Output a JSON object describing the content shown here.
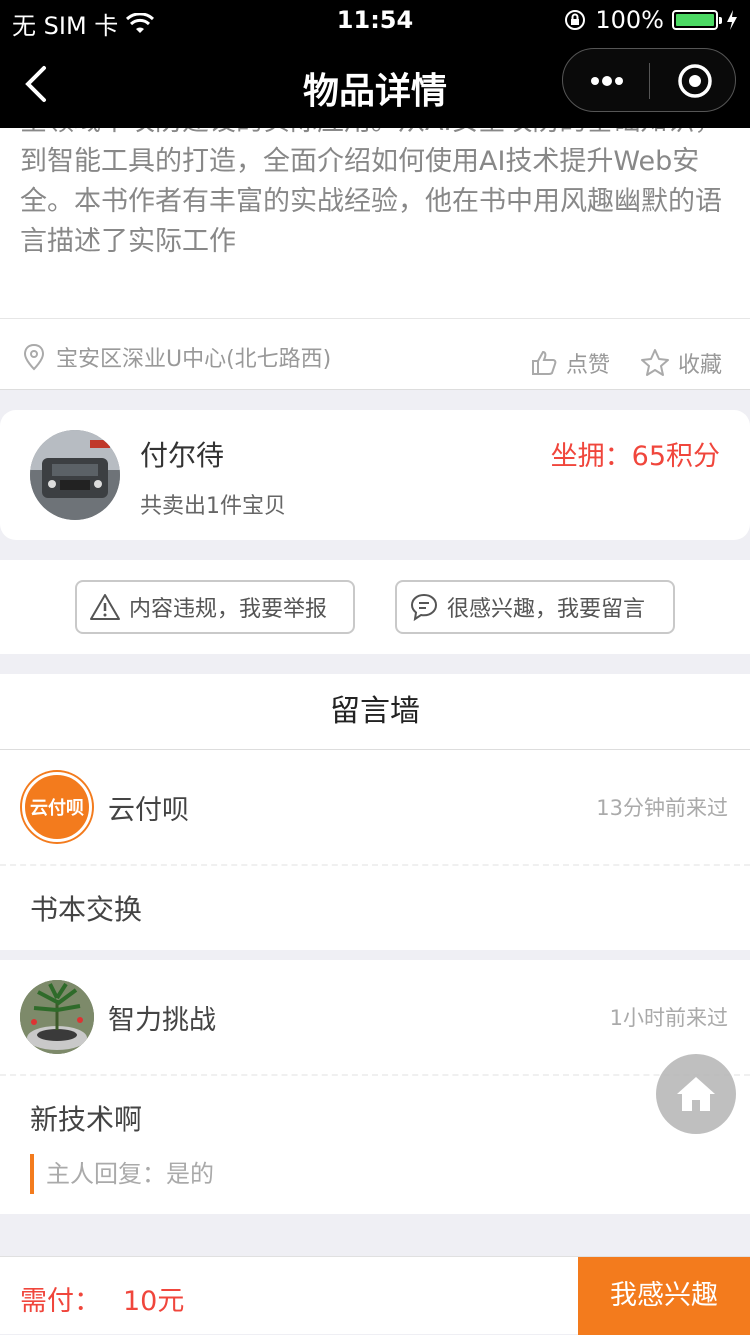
{
  "status_bar": {
    "carrier": "无 SIM 卡",
    "time": "11:54",
    "battery": "100%"
  },
  "nav": {
    "title": "物品详情"
  },
  "description": {
    "text": "全领域中攻防建设的实际应用。从AI安全攻防的基础知识，到智能工具的打造，全面介绍如何使用AI技术提升Web安全。本书作者有丰富的实战经验，他在书中用风趣幽默的语言描述了实际工作"
  },
  "location": {
    "address": "宝安区深业U中心(北七路西)",
    "like_label": "点赞",
    "favorite_label": "收藏"
  },
  "seller": {
    "name": "付尔待",
    "sold": "共卖出1件宝贝",
    "points": "坐拥：65积分"
  },
  "actions": {
    "report": "内容违规，我要举报",
    "comment": "很感兴趣，我要留言"
  },
  "wall": {
    "title": "留言墙",
    "messages": [
      {
        "user": "云付呗",
        "avatar_text": "云付呗",
        "time": "13分钟前来过",
        "content": "书本交换"
      },
      {
        "user": "智力挑战",
        "time": "1小时前来过",
        "content": "新技术啊",
        "reply": "主人回复：是的"
      }
    ]
  },
  "bottom": {
    "price_label": "需付：",
    "price_value": "10元",
    "buy_label": "我感兴趣"
  },
  "colors": {
    "accent": "#f37b1d",
    "price_red": "#f0463c",
    "nav_bg": "#000000"
  }
}
